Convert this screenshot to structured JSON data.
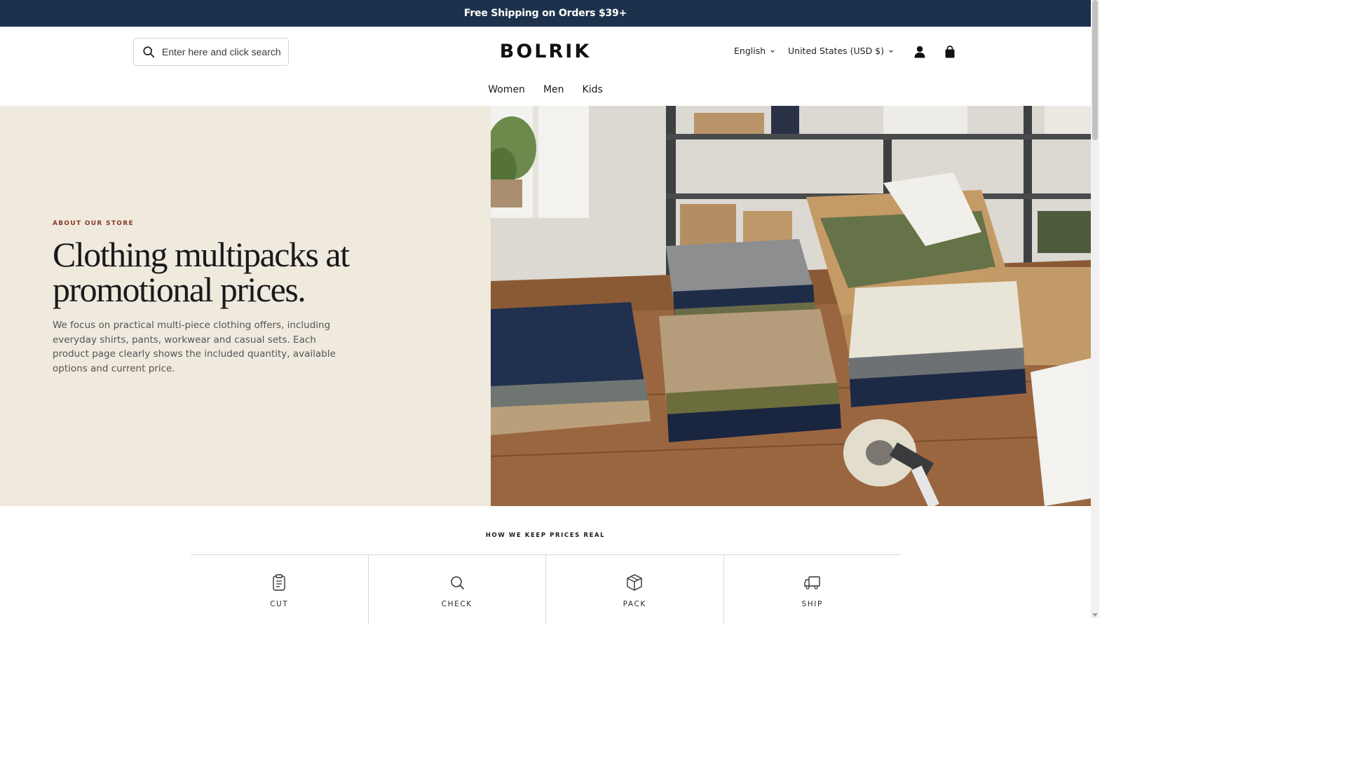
{
  "announcement": {
    "text": "Free Shipping on Orders $39+"
  },
  "header": {
    "search": {
      "placeholder": "Enter here and click search",
      "icon": "search-icon"
    },
    "logo": "BOLRIK",
    "language": "English",
    "country": "United States (USD $)",
    "icons": [
      "user-icon",
      "shopping-bag-icon"
    ]
  },
  "nav": {
    "items": [
      {
        "label": "Women"
      },
      {
        "label": "Men"
      },
      {
        "label": "Kids"
      }
    ]
  },
  "hero": {
    "eyebrow": "ABOUT OUR STORE",
    "title": "Clothing multipacks at promotional prices.",
    "body": "We focus on practical multi-piece clothing offers, including everyday shirts, pants, workwear and casual sets. Each product page clearly shows the included quantity, available options and current price.",
    "image": "photo-folded-clothing-stacks-on-wooden-table"
  },
  "process": {
    "title": "HOW WE KEEP PRICES REAL",
    "steps": [
      {
        "label": "CUT",
        "icon": "clipboard-icon"
      },
      {
        "label": "CHECK",
        "icon": "magnifier-icon"
      },
      {
        "label": "PACK",
        "icon": "box-icon"
      },
      {
        "label": "SHIP",
        "icon": "truck-icon"
      }
    ]
  },
  "colors": {
    "announcement_bg": "#1c314c",
    "hero_bg": "#efe9de",
    "eyebrow": "#8a3a22"
  }
}
